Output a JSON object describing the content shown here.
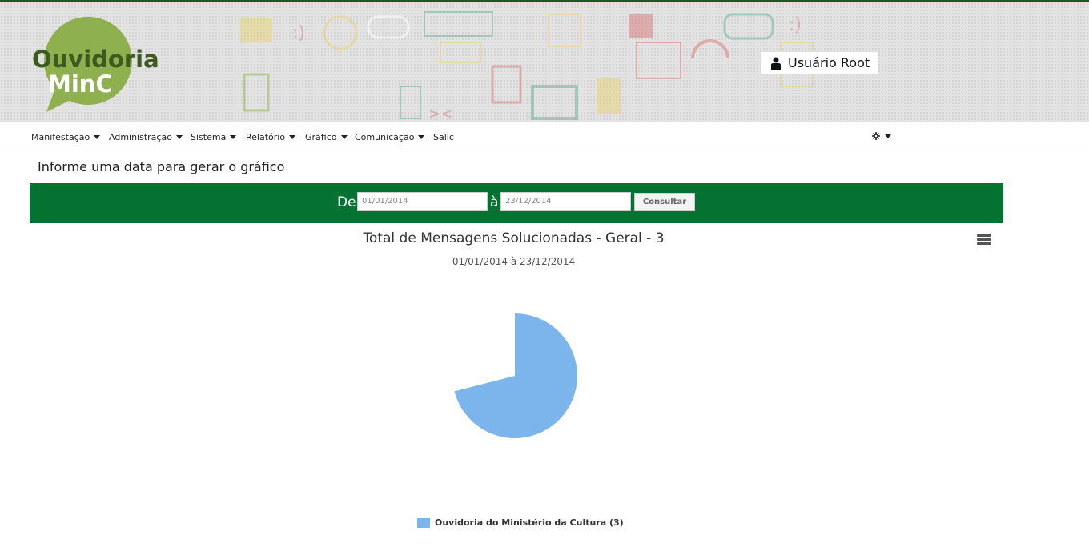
{
  "header": {
    "logo_line1": "Ouvidoria",
    "logo_line2": "MinC",
    "user_label": "Usuário Root"
  },
  "nav": {
    "items": [
      {
        "label": "Manifestação",
        "dropdown": true
      },
      {
        "label": "Administração",
        "dropdown": true
      },
      {
        "label": "Sistema",
        "dropdown": true
      },
      {
        "label": "Relatório",
        "dropdown": true
      },
      {
        "label": "Gráfico",
        "dropdown": true
      },
      {
        "label": "Comunicação",
        "dropdown": true
      },
      {
        "label": "Salic",
        "dropdown": false
      }
    ]
  },
  "page": {
    "heading": "Informe uma data para gerar o gráfico"
  },
  "filter": {
    "from_label": "De",
    "from_value": "01/01/2014",
    "to_label": "à",
    "to_value": "23/12/2014",
    "submit_label": "Consultar"
  },
  "colors": {
    "brand_green": "#047331",
    "logo_green": "#8fb04f",
    "series_blue": "#7cb5ec"
  },
  "chart_data": {
    "type": "pie",
    "title": "Total de Mensagens Solucionadas - Geral - 3",
    "subtitle": "01/01/2014 à 23/12/2014",
    "legend_placement": "bottom-center",
    "series": [
      {
        "name": "Ouvidoria do Ministério da Cultura (3)",
        "value": 3,
        "fraction": 0.71
      }
    ]
  }
}
